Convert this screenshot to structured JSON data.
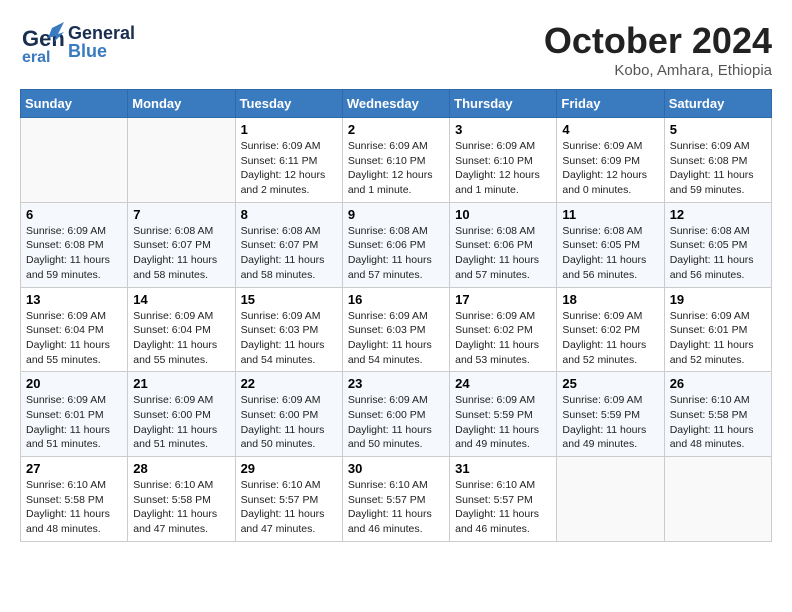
{
  "header": {
    "logo_general": "General",
    "logo_blue": "Blue",
    "month": "October 2024",
    "location": "Kobo, Amhara, Ethiopia"
  },
  "weekdays": [
    "Sunday",
    "Monday",
    "Tuesday",
    "Wednesday",
    "Thursday",
    "Friday",
    "Saturday"
  ],
  "weeks": [
    [
      {
        "day": "",
        "info": ""
      },
      {
        "day": "",
        "info": ""
      },
      {
        "day": "1",
        "info": "Sunrise: 6:09 AM\nSunset: 6:11 PM\nDaylight: 12 hours\nand 2 minutes."
      },
      {
        "day": "2",
        "info": "Sunrise: 6:09 AM\nSunset: 6:10 PM\nDaylight: 12 hours\nand 1 minute."
      },
      {
        "day": "3",
        "info": "Sunrise: 6:09 AM\nSunset: 6:10 PM\nDaylight: 12 hours\nand 1 minute."
      },
      {
        "day": "4",
        "info": "Sunrise: 6:09 AM\nSunset: 6:09 PM\nDaylight: 12 hours\nand 0 minutes."
      },
      {
        "day": "5",
        "info": "Sunrise: 6:09 AM\nSunset: 6:08 PM\nDaylight: 11 hours\nand 59 minutes."
      }
    ],
    [
      {
        "day": "6",
        "info": "Sunrise: 6:09 AM\nSunset: 6:08 PM\nDaylight: 11 hours\nand 59 minutes."
      },
      {
        "day": "7",
        "info": "Sunrise: 6:08 AM\nSunset: 6:07 PM\nDaylight: 11 hours\nand 58 minutes."
      },
      {
        "day": "8",
        "info": "Sunrise: 6:08 AM\nSunset: 6:07 PM\nDaylight: 11 hours\nand 58 minutes."
      },
      {
        "day": "9",
        "info": "Sunrise: 6:08 AM\nSunset: 6:06 PM\nDaylight: 11 hours\nand 57 minutes."
      },
      {
        "day": "10",
        "info": "Sunrise: 6:08 AM\nSunset: 6:06 PM\nDaylight: 11 hours\nand 57 minutes."
      },
      {
        "day": "11",
        "info": "Sunrise: 6:08 AM\nSunset: 6:05 PM\nDaylight: 11 hours\nand 56 minutes."
      },
      {
        "day": "12",
        "info": "Sunrise: 6:08 AM\nSunset: 6:05 PM\nDaylight: 11 hours\nand 56 minutes."
      }
    ],
    [
      {
        "day": "13",
        "info": "Sunrise: 6:09 AM\nSunset: 6:04 PM\nDaylight: 11 hours\nand 55 minutes."
      },
      {
        "day": "14",
        "info": "Sunrise: 6:09 AM\nSunset: 6:04 PM\nDaylight: 11 hours\nand 55 minutes."
      },
      {
        "day": "15",
        "info": "Sunrise: 6:09 AM\nSunset: 6:03 PM\nDaylight: 11 hours\nand 54 minutes."
      },
      {
        "day": "16",
        "info": "Sunrise: 6:09 AM\nSunset: 6:03 PM\nDaylight: 11 hours\nand 54 minutes."
      },
      {
        "day": "17",
        "info": "Sunrise: 6:09 AM\nSunset: 6:02 PM\nDaylight: 11 hours\nand 53 minutes."
      },
      {
        "day": "18",
        "info": "Sunrise: 6:09 AM\nSunset: 6:02 PM\nDaylight: 11 hours\nand 52 minutes."
      },
      {
        "day": "19",
        "info": "Sunrise: 6:09 AM\nSunset: 6:01 PM\nDaylight: 11 hours\nand 52 minutes."
      }
    ],
    [
      {
        "day": "20",
        "info": "Sunrise: 6:09 AM\nSunset: 6:01 PM\nDaylight: 11 hours\nand 51 minutes."
      },
      {
        "day": "21",
        "info": "Sunrise: 6:09 AM\nSunset: 6:00 PM\nDaylight: 11 hours\nand 51 minutes."
      },
      {
        "day": "22",
        "info": "Sunrise: 6:09 AM\nSunset: 6:00 PM\nDaylight: 11 hours\nand 50 minutes."
      },
      {
        "day": "23",
        "info": "Sunrise: 6:09 AM\nSunset: 6:00 PM\nDaylight: 11 hours\nand 50 minutes."
      },
      {
        "day": "24",
        "info": "Sunrise: 6:09 AM\nSunset: 5:59 PM\nDaylight: 11 hours\nand 49 minutes."
      },
      {
        "day": "25",
        "info": "Sunrise: 6:09 AM\nSunset: 5:59 PM\nDaylight: 11 hours\nand 49 minutes."
      },
      {
        "day": "26",
        "info": "Sunrise: 6:10 AM\nSunset: 5:58 PM\nDaylight: 11 hours\nand 48 minutes."
      }
    ],
    [
      {
        "day": "27",
        "info": "Sunrise: 6:10 AM\nSunset: 5:58 PM\nDaylight: 11 hours\nand 48 minutes."
      },
      {
        "day": "28",
        "info": "Sunrise: 6:10 AM\nSunset: 5:58 PM\nDaylight: 11 hours\nand 47 minutes."
      },
      {
        "day": "29",
        "info": "Sunrise: 6:10 AM\nSunset: 5:57 PM\nDaylight: 11 hours\nand 47 minutes."
      },
      {
        "day": "30",
        "info": "Sunrise: 6:10 AM\nSunset: 5:57 PM\nDaylight: 11 hours\nand 46 minutes."
      },
      {
        "day": "31",
        "info": "Sunrise: 6:10 AM\nSunset: 5:57 PM\nDaylight: 11 hours\nand 46 minutes."
      },
      {
        "day": "",
        "info": ""
      },
      {
        "day": "",
        "info": ""
      }
    ]
  ]
}
